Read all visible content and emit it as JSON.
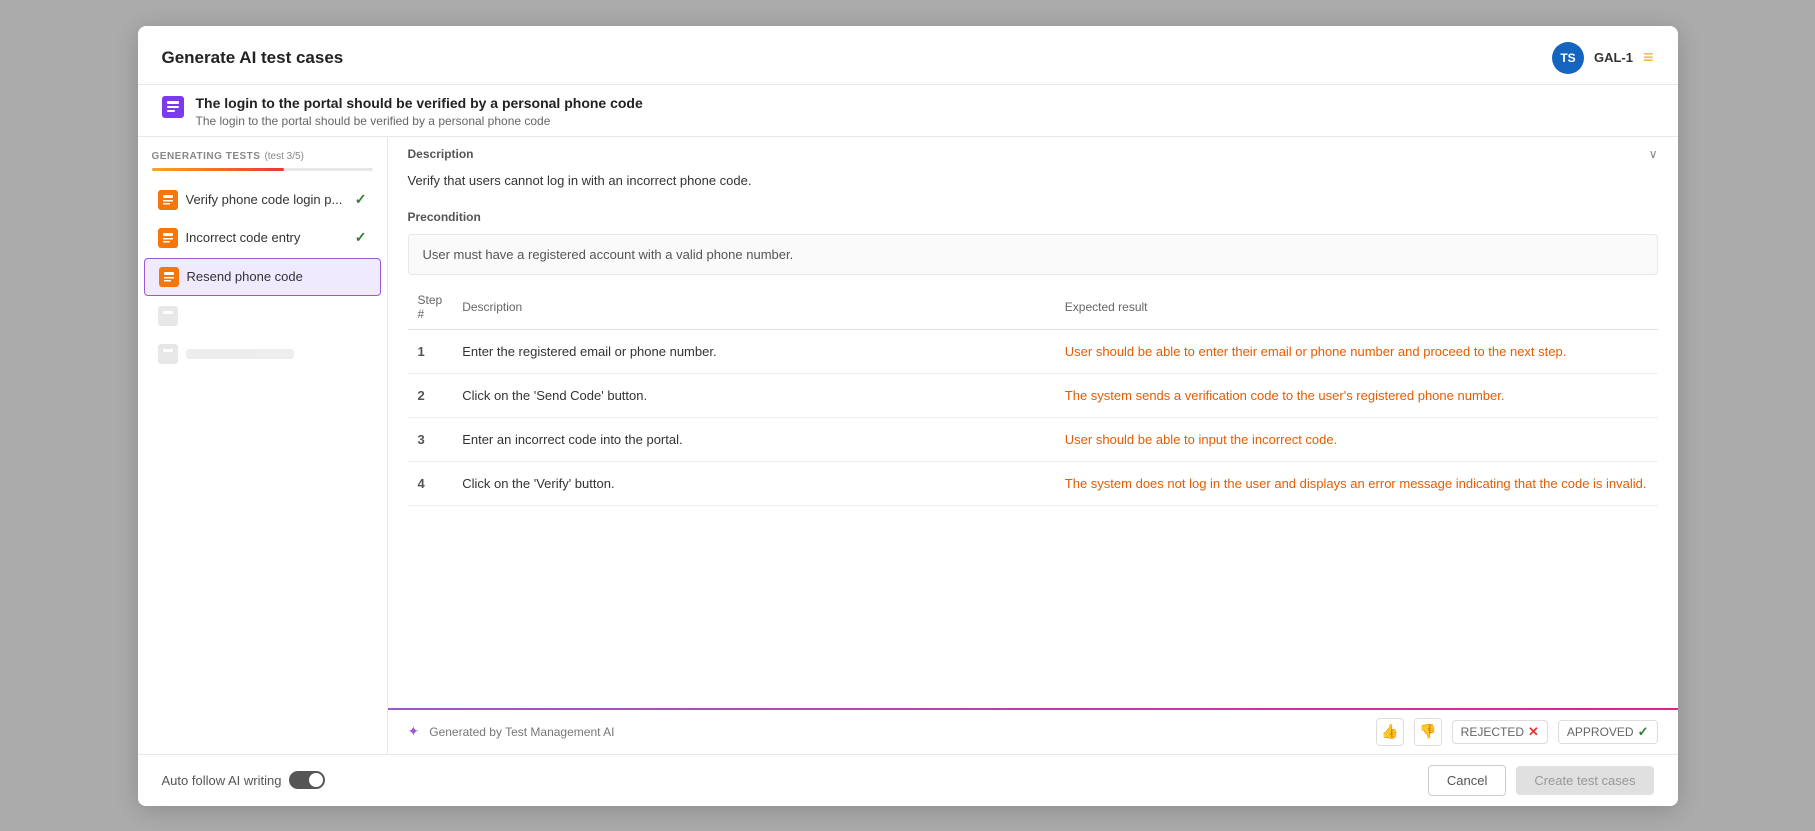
{
  "modal": {
    "title": "Generate AI test cases"
  },
  "header": {
    "avatar_initials": "TS",
    "gal_label": "GAL-1",
    "menu_icon": "≡"
  },
  "story": {
    "title": "The login to the portal should be verified by a personal phone code",
    "description": "The login to the portal should be verified by a personal phone code"
  },
  "sidebar": {
    "generating_label": "GENERATING TESTS",
    "test_progress": "(test 3/5)",
    "items": [
      {
        "label": "Verify phone code login p...",
        "status": "checked",
        "active": false
      },
      {
        "label": "Incorrect code entry",
        "status": "checked",
        "active": false
      },
      {
        "label": "Resend phone code",
        "status": "active",
        "active": true
      },
      {
        "label": "",
        "status": "placeholder",
        "active": false
      },
      {
        "label": "",
        "status": "placeholder",
        "active": false
      }
    ]
  },
  "content": {
    "description_label": "Description",
    "description_text": "Verify that users cannot log in with an incorrect phone code.",
    "precondition_label": "Precondition",
    "precondition_text": "User must have a registered account with a valid phone number.",
    "table": {
      "col_step": "Step #",
      "col_description": "Description",
      "col_expected": "Expected result",
      "rows": [
        {
          "step": "1",
          "description": "Enter the registered email or phone number.",
          "expected": "User should be able to enter their email or phone number and proceed to the next step."
        },
        {
          "step": "2",
          "description": "Click on the 'Send Code' button.",
          "expected": "The system sends a verification code to the user's registered phone number."
        },
        {
          "step": "3",
          "description": "Enter an incorrect code into the portal.",
          "expected": "User should be able to input the incorrect code."
        },
        {
          "step": "4",
          "description": "Click on the 'Verify' button.",
          "expected": "The system does not log in the user and displays an error message indicating that the code is invalid."
        }
      ]
    }
  },
  "footer_bar": {
    "generated_text": "Generated by Test Management AI",
    "rejected_label": "REJECTED",
    "approved_label": "APPROVED"
  },
  "bottom_bar": {
    "auto_follow_label": "Auto follow AI writing",
    "cancel_label": "Cancel",
    "create_label": "Create test cases"
  }
}
